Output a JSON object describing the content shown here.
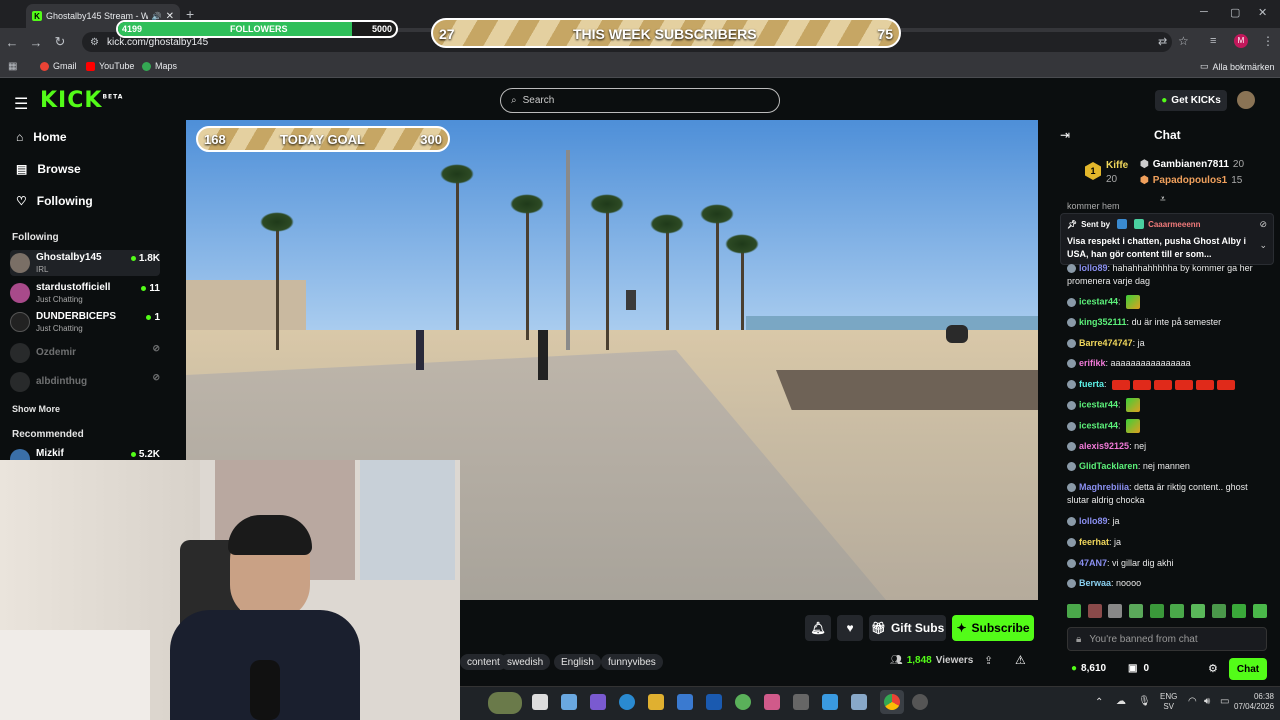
{
  "browser": {
    "tab_title": "Ghostalby145 Stream - Wa",
    "url": "kick.com/ghostalby145",
    "bookmarks": [
      "Gmail",
      "YouTube",
      "Maps"
    ],
    "all_bookmarks": "Alla bokmärken"
  },
  "overlays": {
    "followers": {
      "label": "FOLLOWERS",
      "current": "4199",
      "goal": "5000",
      "progress": 0.84
    },
    "subs": {
      "label": "THIS WEEK SUBSCRIBERS",
      "current": "27",
      "goal": "75"
    },
    "today": {
      "label": "TODAY GOAL",
      "current": "168",
      "goal": "300"
    }
  },
  "header": {
    "logo": "KICK",
    "logo_sup": "BETA",
    "search_placeholder": "Search",
    "get_kicks": "Get KICKs"
  },
  "sidebar": {
    "nav": [
      {
        "label": "Home"
      },
      {
        "label": "Browse"
      },
      {
        "label": "Following"
      }
    ],
    "following_title": "Following",
    "channels": [
      {
        "name": "Ghostalby145",
        "category": "IRL",
        "viewers": "1.8K"
      },
      {
        "name": "stardustofficiell",
        "category": "Just Chatting",
        "viewers": "11"
      },
      {
        "name": "DUNDERBICEPS",
        "category": "Just Chatting",
        "viewers": "1"
      },
      {
        "name": "Ozdemir",
        "category": "",
        "viewers": ""
      },
      {
        "name": "albdinthug",
        "category": "",
        "viewers": ""
      }
    ],
    "show_more": "Show More",
    "recommended_title": "Recommended",
    "recommended": [
      {
        "name": "Mizkif",
        "viewers": "5.2K"
      }
    ]
  },
  "stream": {
    "tags": [
      "content",
      "swedish",
      "English",
      "funnyvibes"
    ],
    "viewers": "1,848",
    "viewers_label": "Viewers",
    "gift_subs": "Gift Subs",
    "subscribe": "Subscribe"
  },
  "chat": {
    "title": "Chat",
    "leaderboard": [
      {
        "rank": "1",
        "name": "Kiffe",
        "count": "20"
      },
      {
        "name": "Gambianen7811",
        "count": "20"
      },
      {
        "name": "Papadopoulos1",
        "count": "15"
      }
    ],
    "partial_top": "kommer hem",
    "pinned": {
      "sent_by": "Sent by",
      "user": "Caaarmeeenn",
      "text": "Visa respekt i chatten, pusha Ghost Alby i USA, han gör content till er som..."
    },
    "messages": [
      {
        "user": "lollo89",
        "text": "hahahhahhhhha by kommer ga her promenera varje dag",
        "color": "#8a8ff0"
      },
      {
        "user": "icestar44",
        "text": "",
        "color": "#5cf07a",
        "emote": true
      },
      {
        "user": "king352111",
        "text": "du är inte på semester",
        "color": "#5cf07a"
      },
      {
        "user": "Barre474747",
        "text": "ja",
        "color": "#f0d75c"
      },
      {
        "user": "erifikk",
        "text": "aaaaaaaaaaaaaaaa",
        "color": "#f07ad7"
      },
      {
        "user": "fuerta",
        "text": "",
        "color": "#5cf0e6",
        "fire": true
      },
      {
        "user": "icestar44",
        "text": "",
        "color": "#5cf07a",
        "emote": true
      },
      {
        "user": "icestar44",
        "text": "",
        "color": "#5cf07a",
        "emote": true
      },
      {
        "user": "alexis92125",
        "text": "nej",
        "color": "#f07ad7"
      },
      {
        "user": "GlidTacklaren",
        "text": "nej mannen",
        "color": "#5cf07a"
      },
      {
        "user": "Maghrebiiia",
        "text": "detta är riktig content.. ghost slutar aldrig chocka",
        "color": "#8a8ff0"
      },
      {
        "user": "lollo89",
        "text": "ja",
        "color": "#8a8ff0"
      },
      {
        "user": "feerhat",
        "text": "ja",
        "color": "#f0d75c"
      },
      {
        "user": "47AN7",
        "text": "vi gillar dig akhi",
        "color": "#8a8ff0"
      },
      {
        "user": "Berwaa",
        "text": "noooo",
        "color": "#8ad0f0"
      }
    ],
    "banned_placeholder": "You're banned from chat",
    "kicks": "8,610",
    "items": "0",
    "send": "Chat"
  },
  "taskbar": {
    "lang": "ENG",
    "layout": "SV",
    "time": "06:38",
    "date": "07/04/2026"
  }
}
